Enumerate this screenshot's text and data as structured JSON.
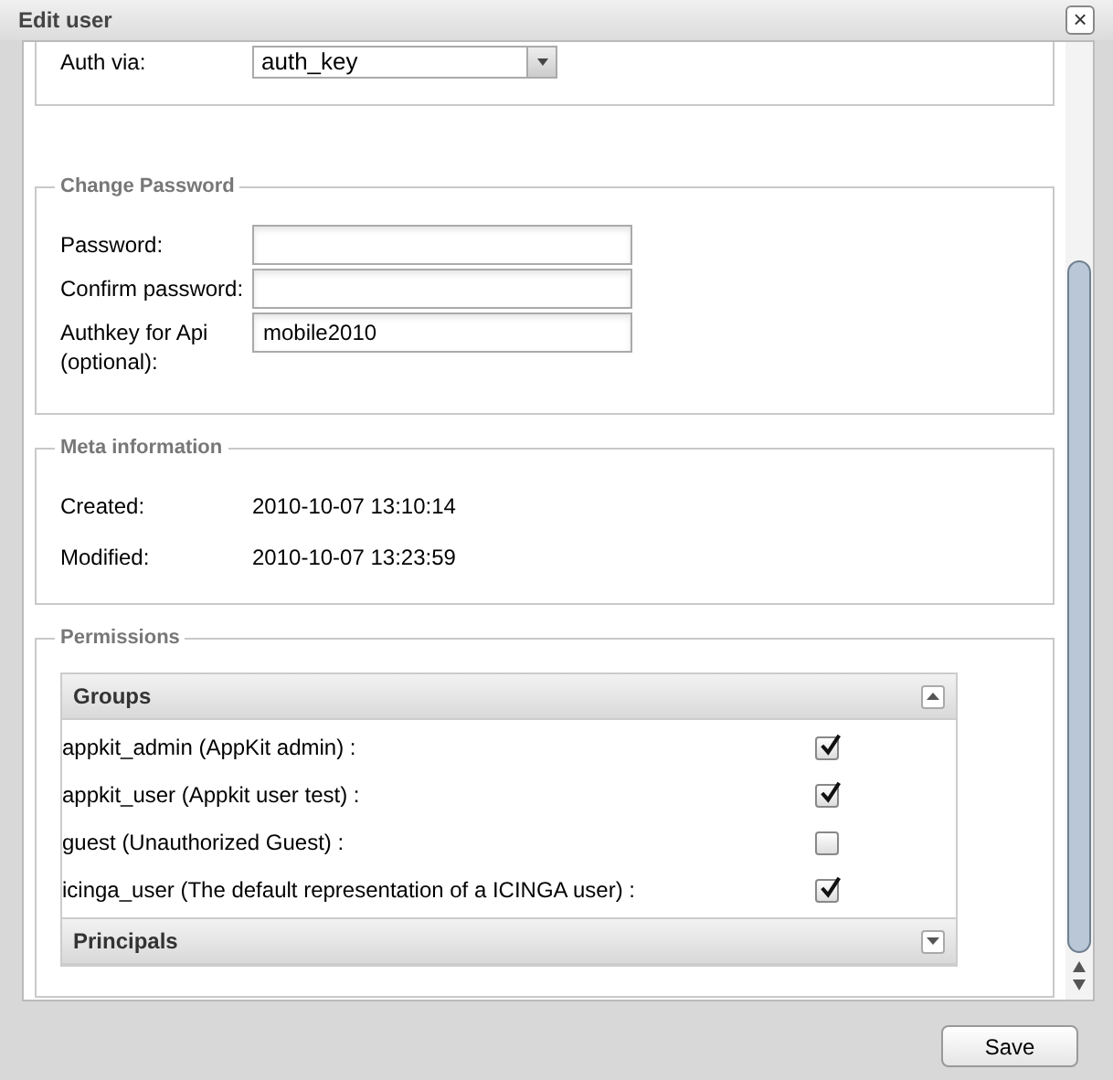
{
  "window": {
    "title": "Edit user",
    "close": "×"
  },
  "auth": {
    "label": "Auth via:",
    "value": "auth_key"
  },
  "change_password": {
    "legend": "Change Password",
    "fields": [
      {
        "label": "Password:"
      },
      {
        "label": "Confirm password:"
      },
      {
        "label": "Authkey for Api (optional):",
        "value": "mobile2010"
      }
    ]
  },
  "meta": {
    "legend": "Meta information",
    "rows": [
      {
        "label": "Created:",
        "value": "2010-10-07 13:10:14"
      },
      {
        "label": "Modified:",
        "value": "2010-10-07 13:23:59"
      }
    ]
  },
  "permissions": {
    "legend": "Permissions",
    "panels": [
      {
        "title": "Groups",
        "expanded": true,
        "items": [
          {
            "label": "appkit_admin (AppKit admin) :",
            "checked": true
          },
          {
            "label": "appkit_user (Appkit user test) :",
            "checked": true
          },
          {
            "label": "guest (Unauthorized Guest) :",
            "checked": false
          },
          {
            "label": "icinga_user (The default representation of a ICINGA user) :",
            "checked": true
          }
        ]
      },
      {
        "title": "Principals",
        "expanded": false
      }
    ]
  },
  "buttons": [
    "Save"
  ]
}
